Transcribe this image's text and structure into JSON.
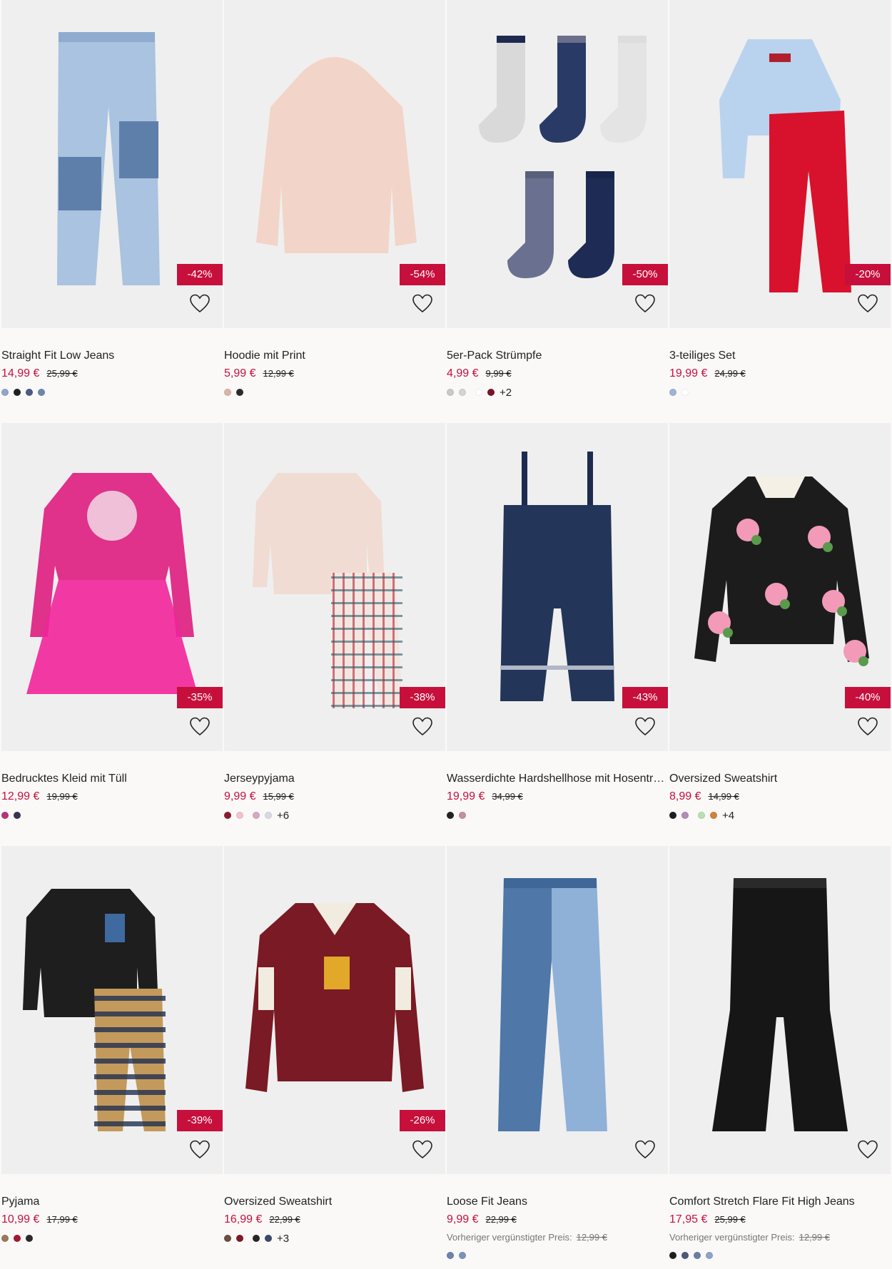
{
  "products": [
    {
      "name": "Straight Fit Low Jeans",
      "price": "14,99 €",
      "old_price": "25,99 €",
      "discount": "-42%",
      "swatches": [
        "#8fa6c9",
        "#1f1f24",
        "#4a5b86",
        "#6f87b0"
      ],
      "more": "",
      "art": "jeans-patch"
    },
    {
      "name": "Hoodie mit Print",
      "price": "5,99 €",
      "old_price": "12,99 €",
      "discount": "-54%",
      "swatches": [
        "#d8b5a6",
        "#2b2b2b"
      ],
      "more": "",
      "art": "hoodie-check"
    },
    {
      "name": "5er-Pack Strümpfe",
      "price": "4,99 €",
      "old_price": "9,99 €",
      "discount": "-50%",
      "swatches": [
        "#c9c9c9",
        "#d4d4d4",
        "#ffffff",
        "#7a1526"
      ],
      "more": "+2",
      "art": "socks"
    },
    {
      "name": "3-teiliges Set",
      "price": "19,99 €",
      "old_price": "24,99 €",
      "discount": "-20%",
      "swatches": [
        "#9fb4d6",
        "#ffffff"
      ],
      "more": "",
      "art": "set"
    },
    {
      "name": "Bedrucktes Kleid mit Tüll",
      "price": "12,99 €",
      "old_price": "19,99 €",
      "discount": "-35%",
      "swatches": [
        "#b5357a",
        "#3b3350"
      ],
      "more": "",
      "art": "dress"
    },
    {
      "name": "Jerseypyjama",
      "price": "9,99 €",
      "old_price": "15,99 €",
      "discount": "-38%",
      "swatches": [
        "#8c1b2f",
        "#f0c4cf",
        "#d7a8c6",
        "#d9d9e6"
      ],
      "more": "+6",
      "art": "pyjama-plaid"
    },
    {
      "name": "Wasserdichte Hardshellhose mit Hosenträgern",
      "price": "19,99 €",
      "old_price": "34,99 €",
      "discount": "-43%",
      "swatches": [
        "#232323",
        "#c78f9e"
      ],
      "more": "",
      "art": "overalls"
    },
    {
      "name": "Oversized Sweatshirt",
      "price": "8,99 €",
      "old_price": "14,99 €",
      "discount": "-40%",
      "swatches": [
        "#1e1e1e",
        "#b38bb8",
        "#b8e0b0",
        "#d0843a"
      ],
      "more": "+4",
      "art": "sweat-floral"
    },
    {
      "name": "Pyjama",
      "price": "10,99 €",
      "old_price": "17,99 €",
      "discount": "-39%",
      "swatches": [
        "#9a7a5c",
        "#a3192e",
        "#2b2b2b"
      ],
      "more": "",
      "art": "pyjama-black"
    },
    {
      "name": "Oversized Sweatshirt",
      "price": "16,99 €",
      "old_price": "22,99 €",
      "discount": "-26%",
      "swatches": [
        "#6b4f3f",
        "#7d1b25",
        "#252525",
        "#3b4a6b"
      ],
      "more": "+3",
      "art": "sweat-hogwarts"
    },
    {
      "name": "Loose Fit Jeans",
      "price": "9,99 €",
      "old_price": "22,99 €",
      "discount": "",
      "prev_label": "Vorheriger vergünstigter Preis:",
      "prev_value": "12,99 €",
      "swatches": [
        "#6e84ab",
        "#7d93b8"
      ],
      "more": "",
      "art": "jeans-loose"
    },
    {
      "name": "Comfort Stretch Flare Fit High Jeans",
      "price": "17,95 €",
      "old_price": "25,99 €",
      "discount": "",
      "prev_label": "Vorheriger vergünstigter Preis:",
      "prev_value": "12,99 €",
      "swatches": [
        "#1f1f1f",
        "#4d5a78",
        "#6a7ea6",
        "#8da3c8"
      ],
      "more": "",
      "art": "jeans-flare"
    }
  ],
  "colors": {
    "sale": "#c70f3c",
    "card_bg": "#efefef",
    "page_bg": "#faf9f8"
  },
  "icons": {
    "favorite": "heart-outline-icon"
  }
}
